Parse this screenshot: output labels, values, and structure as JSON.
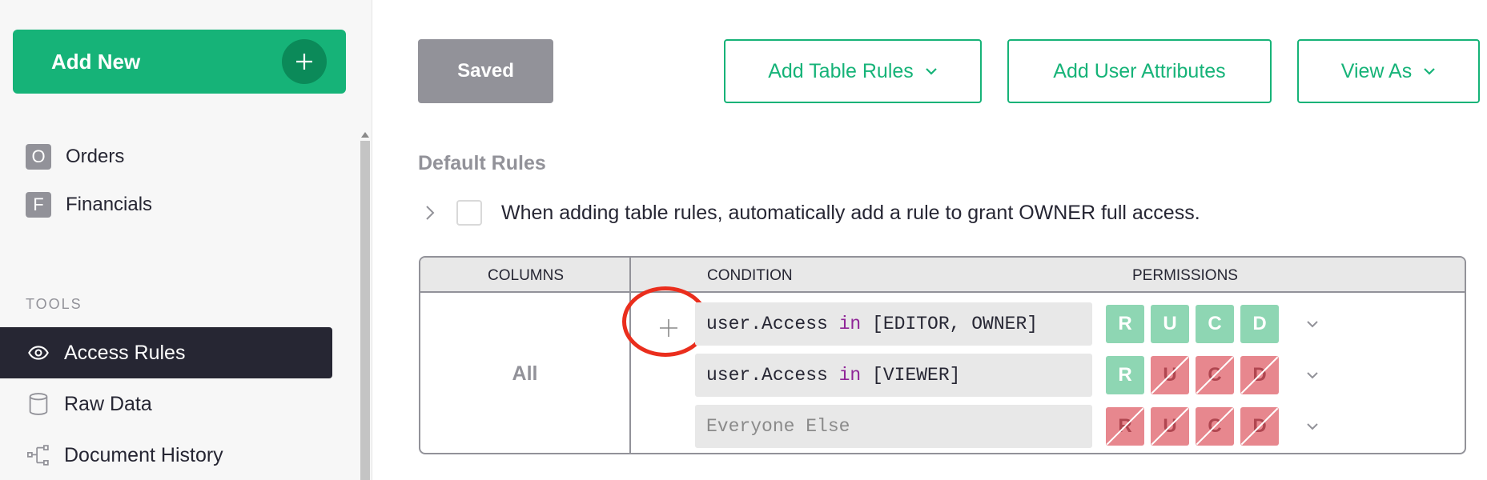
{
  "sidebar": {
    "add_new": "Add New",
    "pages": [
      {
        "badge": "O",
        "label": "Orders"
      },
      {
        "badge": "F",
        "label": "Financials"
      }
    ],
    "tools_label": "TOOLS",
    "tools": [
      {
        "label": "Access Rules",
        "icon": "eye-icon",
        "active": true
      },
      {
        "label": "Raw Data",
        "icon": "database-icon"
      },
      {
        "label": "Document History",
        "icon": "history-icon"
      }
    ]
  },
  "toolbar": {
    "saved": "Saved",
    "add_table_rules": "Add Table Rules",
    "add_user_attributes": "Add User Attributes",
    "view_as": "View As"
  },
  "default_rules": {
    "title": "Default Rules",
    "owner_text": "When adding table rules, automatically add a rule to grant OWNER full access."
  },
  "table": {
    "headers": {
      "columns": "COLUMNS",
      "condition": "CONDITION",
      "permissions": "PERMISSIONS"
    },
    "columns_value": "All",
    "rows": [
      {
        "cond_pre": "user.Access",
        "cond_kw": "in",
        "cond_post": "[EDITOR, OWNER]",
        "perms": [
          "R",
          "U",
          "C",
          "D"
        ],
        "states": [
          "allow",
          "allow",
          "allow",
          "allow"
        ]
      },
      {
        "cond_pre": "user.Access",
        "cond_kw": "in",
        "cond_post": "[VIEWER]",
        "perms": [
          "R",
          "U",
          "C",
          "D"
        ],
        "states": [
          "allow",
          "deny",
          "deny",
          "deny"
        ]
      },
      {
        "placeholder": "Everyone Else",
        "perms": [
          "R",
          "U",
          "C",
          "D"
        ],
        "states": [
          "deny",
          "deny",
          "deny",
          "deny"
        ]
      }
    ]
  },
  "colors": {
    "accent": "#16b378",
    "allow": "#8ed6b3",
    "deny": "#e7878e",
    "annotation": "#ea2e1d"
  }
}
